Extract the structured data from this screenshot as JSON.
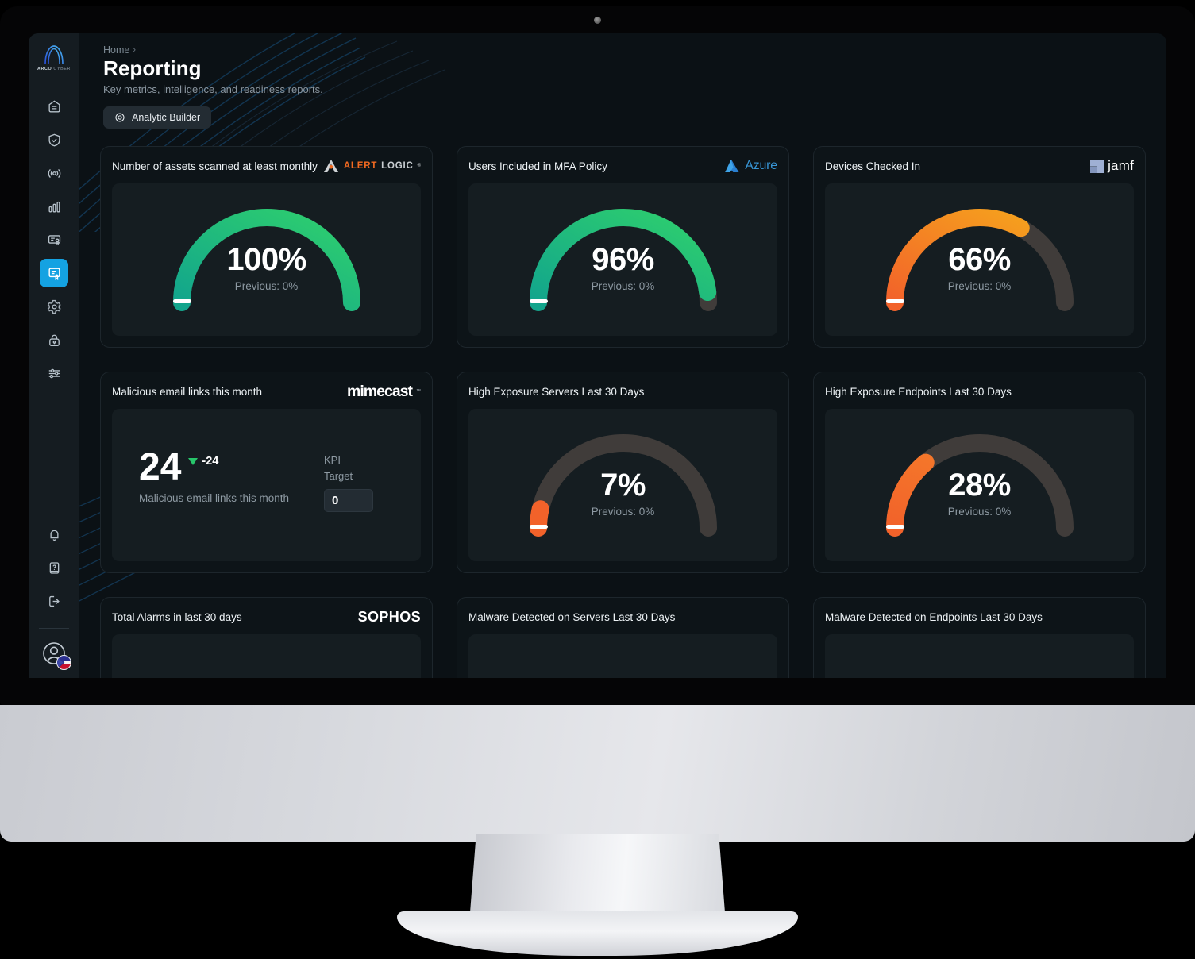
{
  "app": {
    "logo_name": "ARCO",
    "logo_suffix": " CYBER"
  },
  "sidebar": {
    "items": [
      {
        "label": "Dashboard",
        "icon": "home-icon",
        "active": false
      },
      {
        "label": "Protect",
        "icon": "shield-check-icon",
        "active": false
      },
      {
        "label": "Detect",
        "icon": "broadcast-icon",
        "active": false
      },
      {
        "label": "Analytics",
        "icon": "bar-chart-icon",
        "active": false
      },
      {
        "label": "Compliance",
        "icon": "certificate-icon",
        "active": false
      },
      {
        "label": "Reporting",
        "icon": "report-icon",
        "active": true
      },
      {
        "label": "Settings",
        "icon": "gear-icon",
        "active": false
      },
      {
        "label": "Security",
        "icon": "lock-icon",
        "active": false
      },
      {
        "label": "Preferences",
        "icon": "sliders-icon",
        "active": false
      }
    ],
    "bottom_items": [
      {
        "label": "Notifications",
        "icon": "bell-icon"
      },
      {
        "label": "Help",
        "icon": "help-book-icon"
      },
      {
        "label": "Log out",
        "icon": "logout-icon"
      }
    ],
    "account": {
      "label": "Account",
      "icon": "avatar-icon",
      "badge": "flag-badge"
    }
  },
  "header": {
    "breadcrumb_home": "Home",
    "breadcrumb_chevron": "›",
    "title": "Reporting",
    "subtitle": "Key metrics, intelligence, and readiness reports.",
    "analytic_builder_label": "Analytic Builder",
    "analytic_builder_icon": "target-icon"
  },
  "colors": {
    "accent": "#14a2e2",
    "green_start": "#12a58c",
    "green_end": "#2fd06d",
    "orange_start": "#f2622a",
    "orange_end": "#f6a81c",
    "track": "#403c3a",
    "card_bg": "#0d1418",
    "panel_bg": "#151d21",
    "delta_positive": "#27c56a"
  },
  "cards": [
    {
      "title": "Number of assets scanned at least monthly",
      "vendor": "alert-logic",
      "vendor_text_a": "ALERT",
      "vendor_text_b": "LOGIC",
      "type": "gauge",
      "value_label": "100%",
      "previous_label": "Previous: 0%",
      "chart_data": {
        "type": "gauge",
        "title": "Number of assets scanned at least monthly",
        "value": 100,
        "previous": 0,
        "unit": "%",
        "min": 0,
        "max": 100,
        "color_start": "#12a58c",
        "color_end": "#2fd06d",
        "track_color": "#403c3a"
      }
    },
    {
      "title": "Users Included in MFA Policy",
      "vendor": "azure",
      "vendor_text_a": "Azure",
      "type": "gauge",
      "value_label": "96%",
      "previous_label": "Previous: 0%",
      "chart_data": {
        "type": "gauge",
        "title": "Users Included in MFA Policy",
        "value": 96,
        "previous": 0,
        "unit": "%",
        "min": 0,
        "max": 100,
        "color_start": "#12a58c",
        "color_end": "#2fd06d",
        "track_color": "#403c3a"
      }
    },
    {
      "title": "Devices Checked In",
      "vendor": "jamf",
      "vendor_text_a": "jamf",
      "type": "gauge",
      "value_label": "66%",
      "previous_label": "Previous: 0%",
      "chart_data": {
        "type": "gauge",
        "title": "Devices Checked In",
        "value": 66,
        "previous": 0,
        "unit": "%",
        "min": 0,
        "max": 100,
        "color_start": "#f2622a",
        "color_end": "#f6a81c",
        "track_color": "#403c3a"
      }
    },
    {
      "title": "Malicious email links this month",
      "vendor": "mimecast",
      "vendor_text_a": "mimecast",
      "type": "kpi",
      "value_label": "24",
      "delta_label": "-24",
      "delta_direction": "down",
      "caption": "Malicious email links this month",
      "kpi_label_line1": "KPI",
      "kpi_label_line2": "Target",
      "kpi_target_value": "0",
      "chart_data": {
        "type": "kpi",
        "title": "Malicious email links this month",
        "value": 24,
        "delta": -24,
        "target": 0
      }
    },
    {
      "title": "High Exposure Servers Last 30 Days",
      "vendor": "none",
      "type": "gauge",
      "value_label": "7%",
      "previous_label": "Previous: 0%",
      "chart_data": {
        "type": "gauge",
        "title": "High Exposure Servers Last 30 Days",
        "value": 7,
        "previous": 0,
        "unit": "%",
        "min": 0,
        "max": 100,
        "color_start": "#f2622a",
        "color_end": "#f2622a",
        "track_color": "#403c3a"
      }
    },
    {
      "title": "High Exposure Endpoints Last 30 Days",
      "vendor": "none",
      "type": "gauge",
      "value_label": "28%",
      "previous_label": "Previous: 0%",
      "chart_data": {
        "type": "gauge",
        "title": "High Exposure Endpoints Last 30 Days",
        "value": 28,
        "previous": 0,
        "unit": "%",
        "min": 0,
        "max": 100,
        "color_start": "#f2622a",
        "color_end": "#f5812a",
        "track_color": "#403c3a"
      }
    },
    {
      "title": "Total Alarms in last 30 days",
      "vendor": "sophos",
      "vendor_text_a": "SOPHOS",
      "type": "partial",
      "chart_data": {
        "type": "unknown",
        "title": "Total Alarms in last 30 days"
      }
    },
    {
      "title": "Malware Detected on Servers Last 30 Days",
      "vendor": "none",
      "type": "partial",
      "chart_data": {
        "type": "unknown",
        "title": "Malware Detected on Servers Last 30 Days"
      }
    },
    {
      "title": "Malware Detected on Endpoints Last 30 Days",
      "vendor": "none",
      "type": "partial",
      "chart_data": {
        "type": "unknown",
        "title": "Malware Detected on Endpoints Last 30 Days"
      }
    }
  ]
}
